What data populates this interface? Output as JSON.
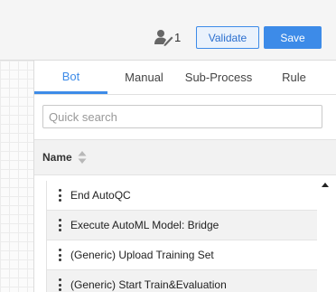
{
  "header": {
    "user_count": "1",
    "validate_label": "Validate",
    "save_label": "Save",
    "accent_color": "#3d8be8"
  },
  "tabs": [
    {
      "label": "Bot",
      "active": true
    },
    {
      "label": "Manual",
      "active": false
    },
    {
      "label": "Sub-Process",
      "active": false
    },
    {
      "label": "Rule",
      "active": false
    }
  ],
  "search": {
    "placeholder": "Quick search",
    "value": ""
  },
  "table": {
    "column_name": "Name",
    "rows": [
      "End AutoQC",
      "Execute AutoML Model: Bridge",
      "(Generic) Upload Training Set",
      "(Generic) Start Train&Evaluation"
    ]
  },
  "icons": {
    "user": "user-edit-icon",
    "sort": "sort-icon",
    "drag": "drag-handle-icon",
    "scroll_up": "scroll-up-arrow-icon"
  }
}
